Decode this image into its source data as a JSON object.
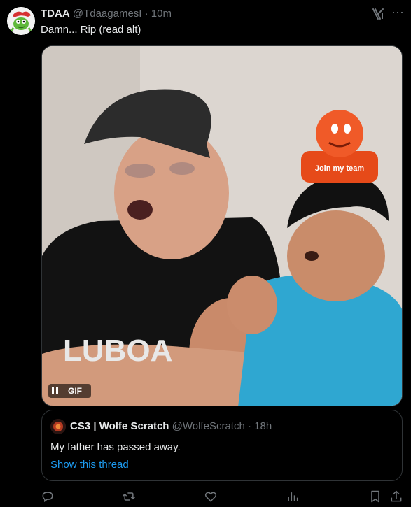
{
  "tweet": {
    "author_name": "TDAA",
    "author_handle": "@TdaagamesI",
    "separator": "·",
    "time": "10m",
    "text": "Damn... Rip (read alt)",
    "media": {
      "type": "GIF",
      "badge_label": "GIF",
      "overlay_card_text": "Join my team"
    }
  },
  "quote": {
    "author_name": "CS3 | Wolfe Scratch",
    "author_handle": "@WolfeScratch",
    "separator": "·",
    "time": "18h",
    "text": "My father has passed away.",
    "link": "Show this thread"
  },
  "icons": {
    "grok": "grok-icon",
    "more": "more-icon",
    "reply": "reply-icon",
    "repost": "repost-icon",
    "like": "like-icon",
    "views": "views-icon",
    "bookmark": "bookmark-icon",
    "share": "share-icon"
  },
  "colors": {
    "background": "#000000",
    "text": "#e7e9ea",
    "secondary": "#71767b",
    "link": "#1d9bf0",
    "border": "#2f3336"
  }
}
